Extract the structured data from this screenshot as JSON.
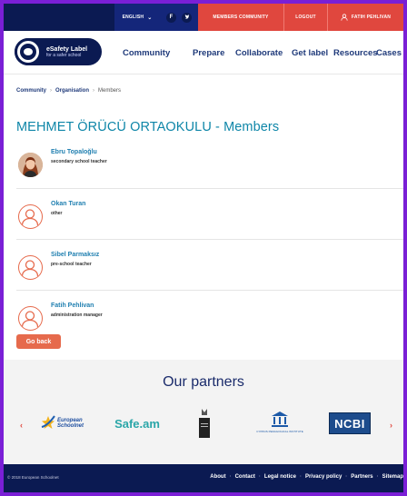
{
  "topbar": {
    "language": "ENGLISH",
    "facebook": "f",
    "twitter": "t",
    "members_community": "MEMBERS COMMUNITY",
    "logout": "LOGOUT",
    "user": "FATIH PEHLIVAN"
  },
  "logo": {
    "line1": "eSafety Label",
    "line2": "for a safer school"
  },
  "nav": [
    "Community",
    "Prepare",
    "Collaborate",
    "Get label",
    "Resources",
    "Cases"
  ],
  "breadcrumb": {
    "items": [
      "Community",
      "Organisation",
      "Members"
    ],
    "separator": "›"
  },
  "page_title": "MEHMET ÖRÜCÜ ORTAOKULU - Members",
  "members": [
    {
      "name": "Ebru Topaloğlu",
      "role": "secondary school teacher",
      "avatar": "photo"
    },
    {
      "name": "Okan Turan",
      "role": "other",
      "avatar": "user-icon"
    },
    {
      "name": "Sibel Parmaksız",
      "role": "pre-school teacher",
      "avatar": "user-icon"
    },
    {
      "name": "Fatih Pehlivan",
      "role": "administration manager",
      "avatar": "user-icon"
    }
  ],
  "go_back": "Go back",
  "partners": {
    "title": "Our partners",
    "logos": [
      "European Schoolnet",
      "Safe.am",
      "",
      "CYPRUS PEDAGOGICAL INSTITUTE",
      "NCBI"
    ],
    "prev": "‹",
    "next": "›"
  },
  "footer": {
    "copyright": "© 2018 European Schoolnet",
    "links": [
      "About",
      "Contact",
      "Legal notice",
      "Privacy policy",
      "Partners",
      "Sitemap"
    ]
  },
  "colors": {
    "navy": "#0b1a52",
    "accent_red": "#e0473e",
    "avatar_orange": "#e66a4c",
    "title_teal": "#0e86a8",
    "frame_purple": "#7a1fd6"
  }
}
